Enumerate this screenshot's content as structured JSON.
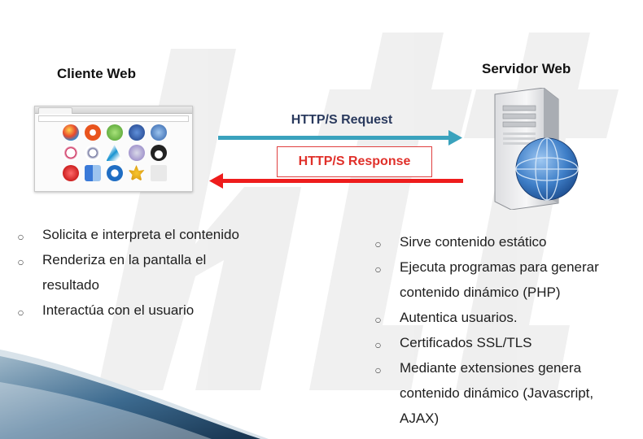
{
  "client": {
    "title": "Cliente Web"
  },
  "server": {
    "title": "Servidor Web"
  },
  "request": {
    "label": "HTTP/S Request"
  },
  "response": {
    "label": "HTTP/S Response"
  },
  "client_features": [
    "Solicita e interpreta el contenido",
    "Renderiza en la pantalla el resultado",
    "Interactúa con el usuario"
  ],
  "server_features": [
    "Sirve contenido estático",
    "Ejecuta programas para generar contenido dinámico (PHP)",
    "Autentica usuarios.",
    "Certificados SSL/TLS",
    "Mediante extensiones genera contenido dinámico (Javascript, AJAX)"
  ],
  "colors": {
    "request_arrow": "#3aa2bd",
    "response_arrow": "#ee1c1c",
    "request_text": "#2a3a5e",
    "response_text": "#e0302a"
  }
}
